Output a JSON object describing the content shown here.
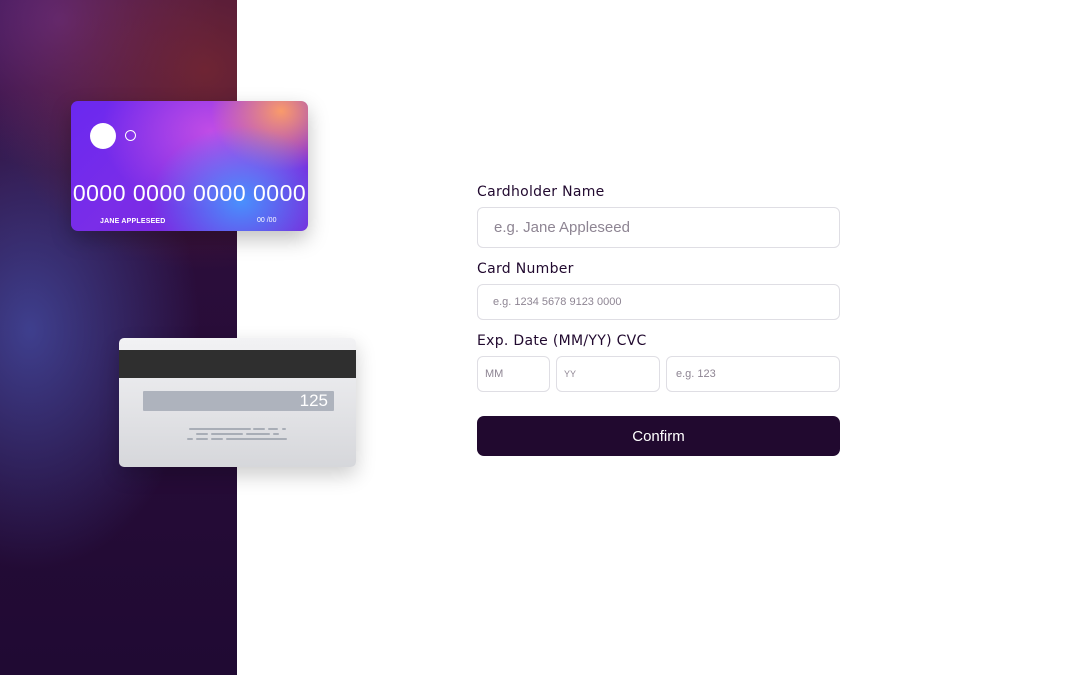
{
  "card_front": {
    "number": "0000 0000 0000 0000",
    "name": "JANE APPLESEED",
    "expiry": "00 /00"
  },
  "card_back": {
    "cvc": "125"
  },
  "form": {
    "name": {
      "label": "Cardholder Name",
      "placeholder": "e.g. Jane Appleseed",
      "value": ""
    },
    "number": {
      "label": "Card Number",
      "placeholder": "e.g. 1234 5678 9123 0000",
      "value": ""
    },
    "exp_cvc_label": "Exp. Date (MM/YY) CVC",
    "month": {
      "placeholder": "MM",
      "value": ""
    },
    "year": {
      "placeholder": "YY",
      "value": ""
    },
    "cvc": {
      "placeholder": "e.g. 123",
      "value": ""
    },
    "confirm_label": "Confirm"
  },
  "colors": {
    "accent": "#21092f",
    "input_border": "#dfdee4",
    "side_panel": "#200a33"
  },
  "icons": [
    "card-logo-filled-circle-icon",
    "card-logo-outline-circle-icon"
  ]
}
